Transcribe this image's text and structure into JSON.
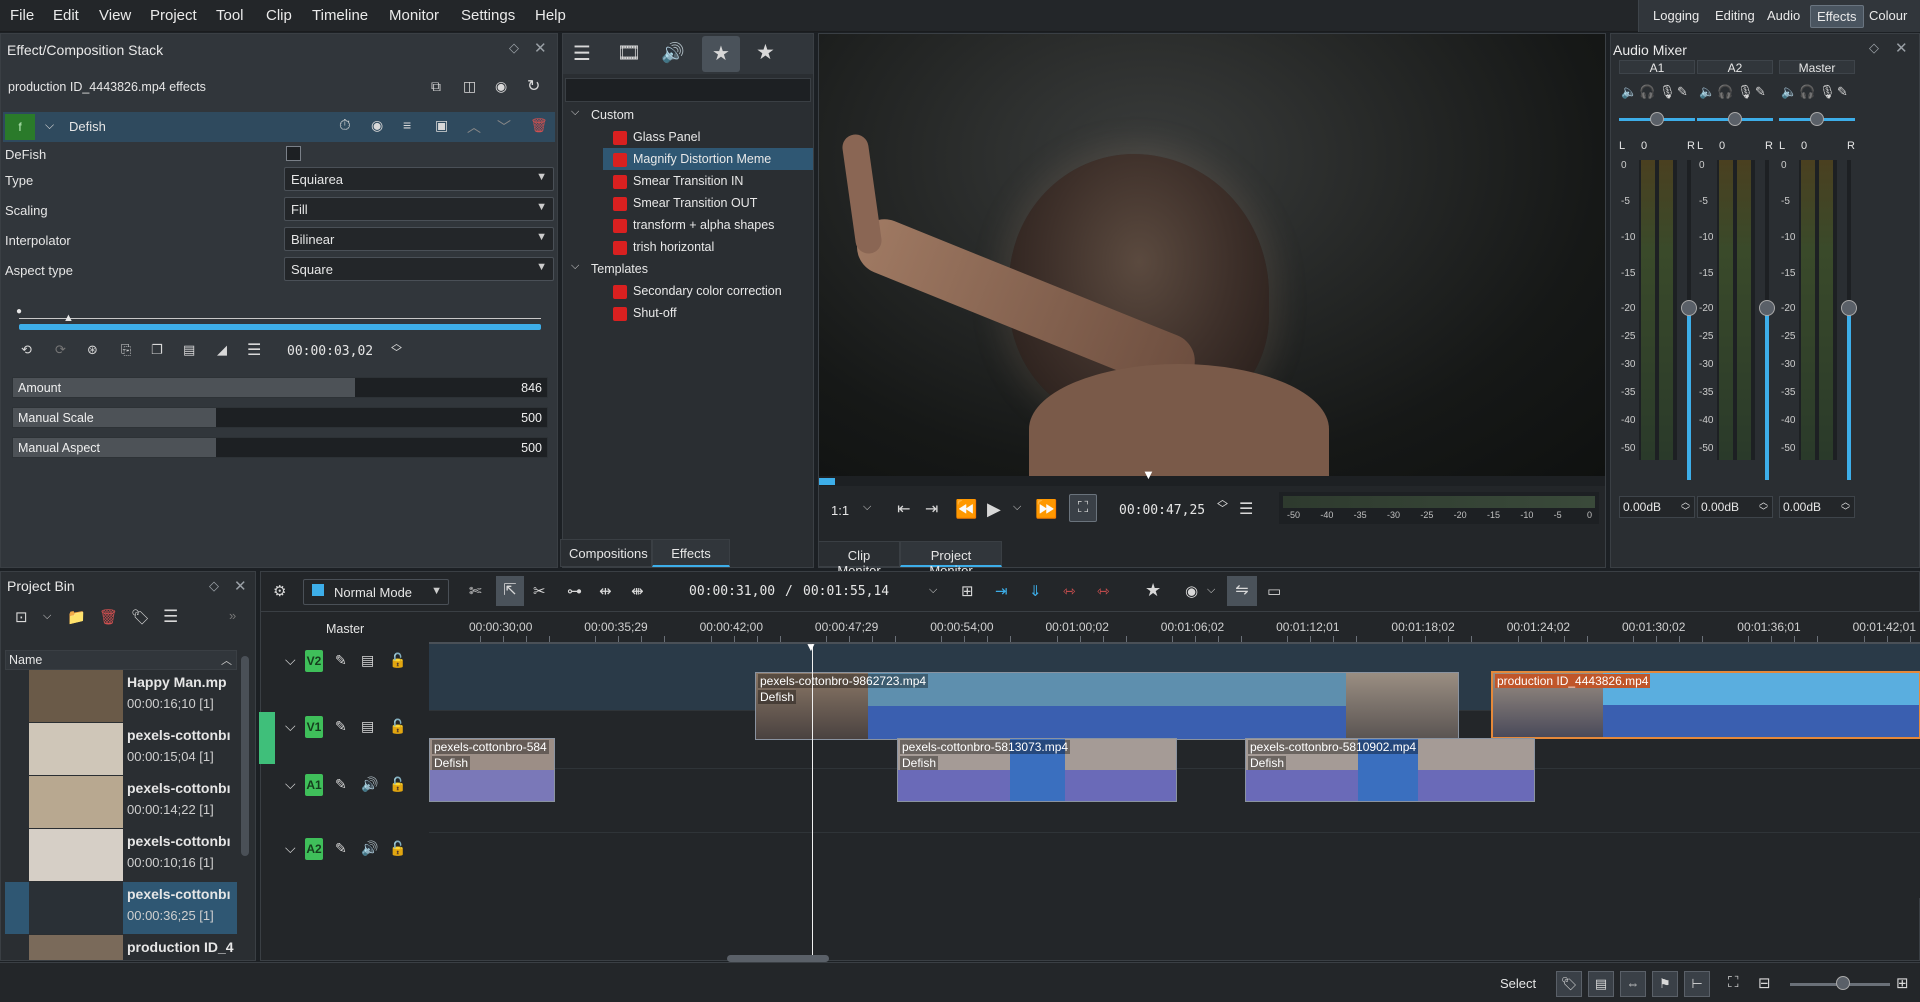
{
  "menu": [
    "File",
    "Edit",
    "View",
    "Project",
    "Tool",
    "Clip",
    "Timeline",
    "Monitor",
    "Settings",
    "Help"
  ],
  "layouts": {
    "items": [
      "Logging",
      "Editing",
      "Audio",
      "Effects",
      "Colour"
    ],
    "active": "Effects"
  },
  "effect_stack": {
    "title": "Effect/Composition Stack",
    "clip_label": "production ID_4443826.mp4 effects",
    "effect_badge": "f",
    "effect_name": "Defish",
    "enable_label": "DeFish",
    "params": [
      {
        "label": "Type",
        "value": "Equiarea"
      },
      {
        "label": "Scaling",
        "value": "Fill"
      },
      {
        "label": "Interpolator",
        "value": "Bilinear"
      },
      {
        "label": "Aspect type",
        "value": "Square"
      }
    ],
    "timecode": "00:00:03,02",
    "sliders": [
      {
        "label": "Amount",
        "value": "846",
        "fill": 0.64
      },
      {
        "label": "Manual Scale",
        "value": "500",
        "fill": 0.38
      },
      {
        "label": "Manual Aspect",
        "value": "500",
        "fill": 0.38
      }
    ]
  },
  "effects_list": {
    "groups": [
      {
        "name": "Custom",
        "items": [
          "Glass Panel",
          "Magnify Distortion Meme",
          "Smear Transition IN",
          "Smear Transition OUT",
          "transform + alpha shapes",
          "trish horizontal"
        ]
      },
      {
        "name": "Templates",
        "items": [
          "Secondary color correction",
          "Shut-off"
        ]
      }
    ],
    "selected": "Magnify Distortion Meme",
    "tabs": [
      "Compositions",
      "Effects"
    ],
    "active_tab": "Effects"
  },
  "monitor": {
    "zoom": "1:1",
    "timecode": "00:00:47,25",
    "meter_scale": [
      "-50",
      "-40",
      "-35",
      "-30",
      "-25",
      "-20",
      "-15",
      "-10",
      "-5",
      "0"
    ],
    "tabs": [
      "Clip Monitor",
      "Project Monitor"
    ],
    "active_tab": "Project Monitor",
    "progress": 0.02
  },
  "audio_mixer": {
    "title": "Audio Mixer",
    "channels": [
      {
        "name": "A1",
        "db": "0.00dB",
        "pan": "0"
      },
      {
        "name": "A2",
        "db": "0.00dB",
        "pan": "0"
      },
      {
        "name": "Master",
        "db": "0.00dB",
        "pan": "0"
      }
    ],
    "lr": [
      "L",
      "R"
    ],
    "scale": [
      "0",
      "-5",
      "-10",
      "-15",
      "-20",
      "-25",
      "-30",
      "-35",
      "-40",
      "-50"
    ]
  },
  "project_bin": {
    "title": "Project Bin",
    "column": "Name",
    "items": [
      {
        "name": "Happy Man.mp",
        "dur": "00:00:16;10 [1]"
      },
      {
        "name": "pexels-cottonbı",
        "dur": "00:00:15;04 [1]"
      },
      {
        "name": "pexels-cottonbı",
        "dur": "00:00:14;22 [1]"
      },
      {
        "name": "pexels-cottonbı",
        "dur": "00:00:10;16 [1]"
      },
      {
        "name": "pexels-cottonbı",
        "dur": "00:00:36;25 [1]"
      },
      {
        "name": "production ID_4",
        "dur": ""
      }
    ]
  },
  "timeline": {
    "mode": "Normal Mode",
    "position": "00:00:31,00",
    "duration": "00:01:55,14",
    "master": "Master",
    "ruler": [
      "00:00:30;00",
      "00:00:35;29",
      "00:00:42;00",
      "00:00:47;29",
      "00:00:54;00",
      "00:01:00;02",
      "00:01:06;02",
      "00:01:12;01",
      "00:01:18;02",
      "00:01:24;02",
      "00:01:30;02",
      "00:01:36;01",
      "00:01:42;01"
    ],
    "tracks": [
      "V2",
      "V1",
      "A1",
      "A2"
    ],
    "clips": [
      {
        "name": "pexels-cottonbro-9862723.mp4",
        "fx": "Defish"
      },
      {
        "name": "production ID_4443826.mp4",
        "fx": ""
      },
      {
        "name": "pexels-cottonbro-584",
        "fx": "Defish"
      },
      {
        "name": "pexels-cottonbro-5813073.mp4",
        "fx": "Defish"
      },
      {
        "name": "pexels-cottonbro-5810902.mp4",
        "fx": "Defish"
      }
    ]
  },
  "status": {
    "tool": "Select"
  }
}
